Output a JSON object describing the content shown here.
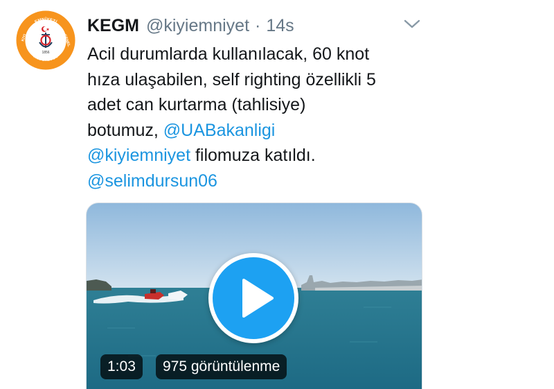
{
  "tweet": {
    "display_name": "KEGM",
    "handle": "@kiyiemniyet",
    "separator": "·",
    "time": "14s",
    "text_lines": [
      [
        {
          "t": "Acil durumlarda kullanılacak, 60 knot",
          "mention": false
        }
      ],
      [
        {
          "t": "hıza ulaşabilen, self righting özellikli 5",
          "mention": false
        }
      ],
      [
        {
          "t": "adet can kurtarma (tahlisiye)",
          "mention": false
        }
      ],
      [
        {
          "t": "botumuz, ",
          "mention": false
        },
        {
          "t": "@UABakanligi",
          "mention": true
        }
      ],
      [
        {
          "t": "@kiyiemniyet",
          "mention": true
        },
        {
          "t": " filomuza katıldı.",
          "mention": false
        }
      ],
      [
        {
          "t": "@selimdursun06",
          "mention": true
        }
      ]
    ]
  },
  "avatar": {
    "ring_top": "EMNİYETİ",
    "ring_left": "KIYI",
    "ring_right": "GENEL",
    "ring_bottom": "MÜDÜRLÜĞÜ",
    "year": "1856",
    "ring_color": "#f7941d"
  },
  "video": {
    "duration": "1:03",
    "views": "975 görüntülenme"
  },
  "icons": {
    "caret": "chevron-down-icon",
    "play": "play-icon"
  },
  "colors": {
    "link": "#1b95e0",
    "play_button": "#1da1f2",
    "secondary_text": "#657786"
  }
}
